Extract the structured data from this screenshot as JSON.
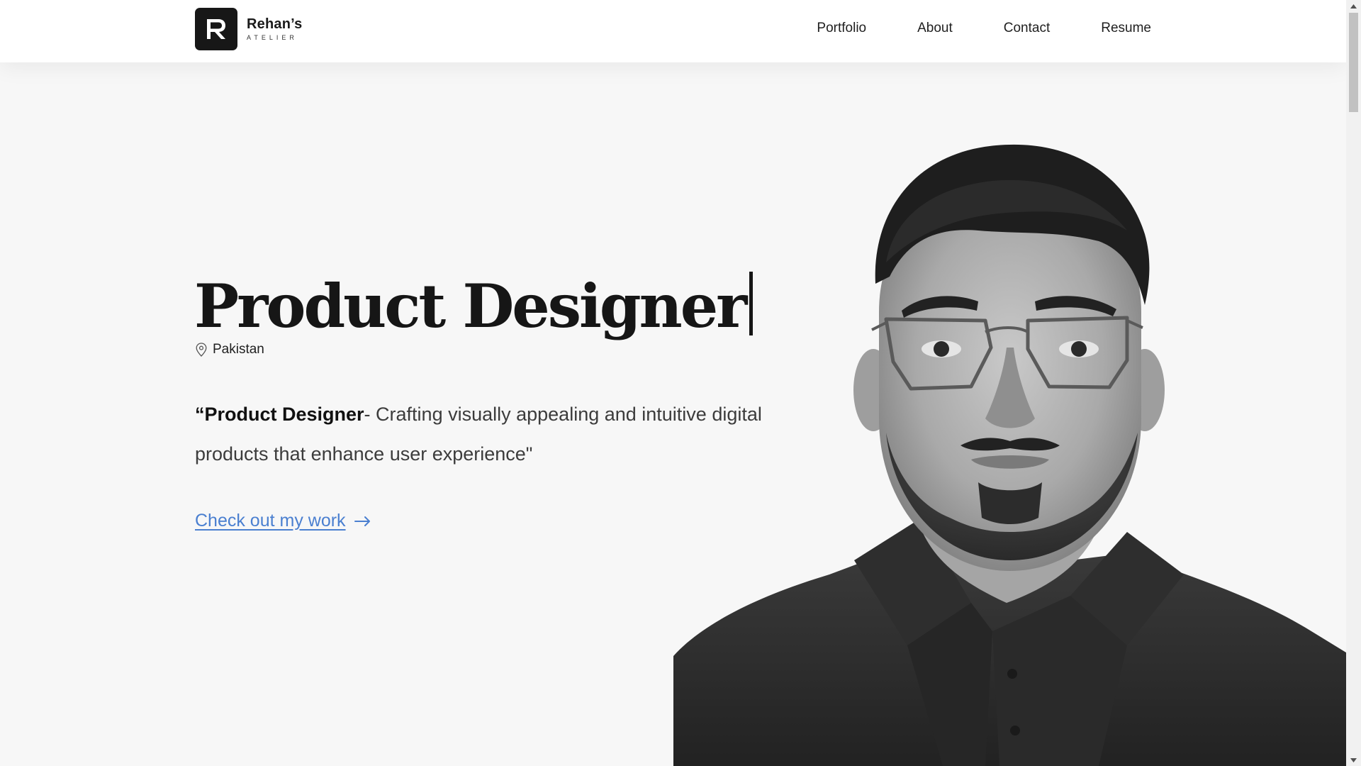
{
  "header": {
    "logo": {
      "letter": "R",
      "name": "Rehan’s",
      "subtitle": "ATELIER"
    },
    "nav": [
      {
        "label": "Portfolio"
      },
      {
        "label": "About"
      },
      {
        "label": "Contact"
      },
      {
        "label": "Resume"
      }
    ]
  },
  "hero": {
    "title": "Product Designer",
    "location": "Pakistan",
    "tagline": {
      "lead": "“Product Designer",
      "rest": "- Crafting visually appealing and intuitive digital products that enhance user experience\""
    },
    "cta": "Check out my work"
  },
  "colors": {
    "page_background": "#f7f7f7",
    "header_background": "#ffffff",
    "link": "#4a7fd0",
    "text": "#1a1a1a",
    "logo_mark": "#171717"
  },
  "icons": {
    "location": "map-pin-icon",
    "cta_arrow": "arrow-right-icon"
  }
}
